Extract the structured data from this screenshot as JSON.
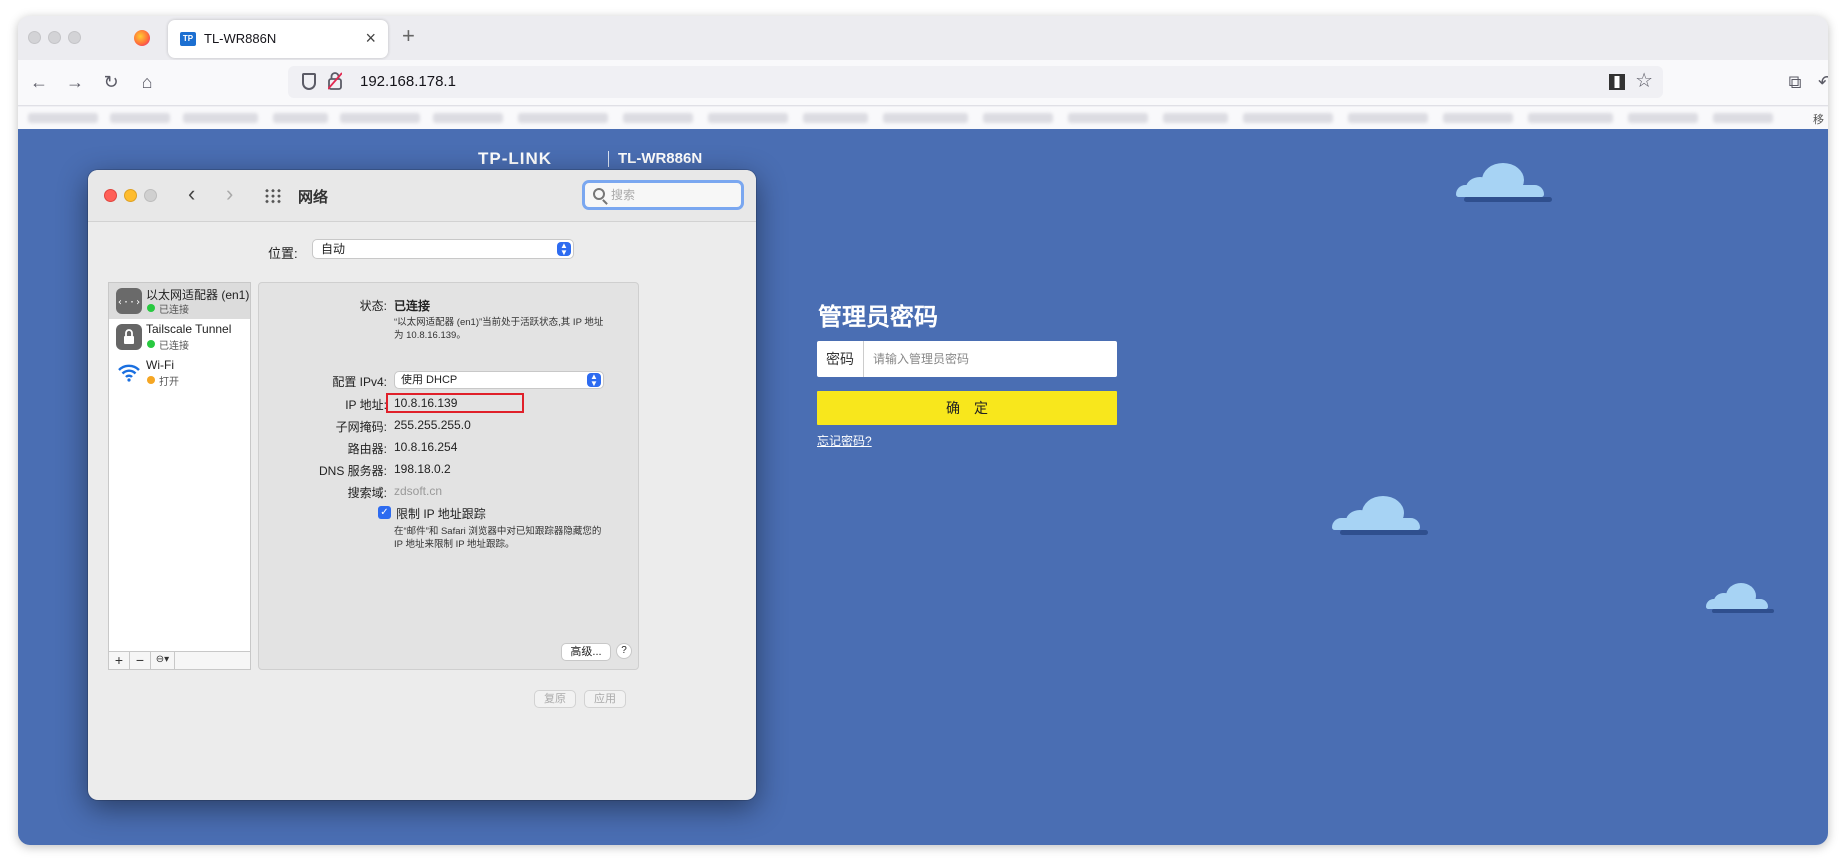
{
  "browser": {
    "tab_title": "TL-WR886N",
    "tab_favicon": "TP",
    "tab_close": "×",
    "new_tab": "+",
    "url": "192.168.178.1",
    "bookmarks_overflow": "移",
    "icons": {
      "back": "←",
      "forward": "→",
      "reload": "↻",
      "home": "⌂",
      "star": "☆",
      "crop": "⧉",
      "undo": "↶"
    }
  },
  "router": {
    "logo": "TP-LINK",
    "model": "TL-WR886N",
    "admin_title": "管理员密码",
    "password_label": "密码",
    "password_placeholder": "请输入管理员密码",
    "confirm_label": "确定",
    "forgot_link": "忘记密码?"
  },
  "network_window": {
    "title": "网络",
    "search_placeholder": "搜索",
    "location_label": "位置:",
    "location_value": "自动",
    "services": [
      {
        "name": "以太网适配器 (en1)",
        "status": "已连接",
        "status_color": "#28c940"
      },
      {
        "name": "Tailscale Tunnel",
        "status": "已连接",
        "status_color": "#28c940"
      },
      {
        "name": "Wi-Fi",
        "status": "打开",
        "status_color": "#f5a623"
      }
    ],
    "sidebar_buttons": {
      "add": "+",
      "remove": "−",
      "action": "⊖▾"
    },
    "detail": {
      "status_label": "状态:",
      "status_value": "已连接",
      "status_desc": "“以太网适配器 (en1)”当前处于活跃状态,其 IP 地址为 10.8.16.139。",
      "configure_label": "配置 IPv4:",
      "configure_value": "使用 DHCP",
      "ip_label": "IP 地址:",
      "ip_value": "10.8.16.139",
      "subnet_label": "子网掩码:",
      "subnet_value": "255.255.255.0",
      "router_label": "路由器:",
      "router_value": "10.8.16.254",
      "dns_label": "DNS 服务器:",
      "dns_value": "198.18.0.2",
      "search_domain_label": "搜索域:",
      "search_domain_value": "zdsoft.cn",
      "limit_tracking_label": "限制 IP 地址跟踪",
      "limit_tracking_desc": "在“邮件”和 Safari 浏览器中对已知跟踪器隐藏您的 IP 地址来限制 IP 地址跟踪。",
      "advanced_label": "高级...",
      "help_label": "?"
    },
    "revert_label": "复原",
    "apply_label": "应用"
  },
  "colors": {
    "page_bg": "#4a6eb3",
    "confirm_btn": "#f8e71c",
    "highlight_box": "#e0202a",
    "accent_blue": "#2d6bf0"
  }
}
